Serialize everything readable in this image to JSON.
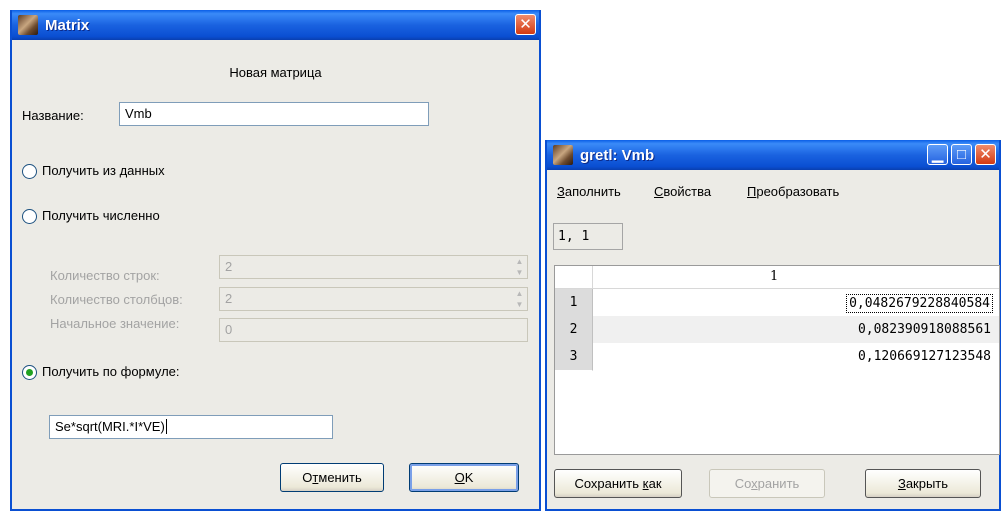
{
  "matrix_dialog": {
    "title": "Matrix",
    "subtitle": "Новая матрица",
    "name_label": "Название:",
    "name_value": "Vmb",
    "option_from_data": "Получить из данных",
    "option_numeric": "Получить численно",
    "rows_label": "Количество строк:",
    "rows_value": "2",
    "cols_label": "Количество столбцов:",
    "cols_value": "2",
    "init_label": "Начальное значение:",
    "init_value": "0",
    "option_formula": "Получить по формуле:",
    "formula_value": "Se*sqrt(MRI.*I*VE)",
    "selected_option": "formula",
    "cancel_prefix": "О",
    "cancel_mnemonic": "т",
    "cancel_suffix": "менить",
    "ok_mnemonic": "O",
    "ok_suffix": "K"
  },
  "gretl_window": {
    "title": "gretl: Vmb",
    "menu": {
      "fill_mnemonic": "З",
      "fill_rest": "аполнить",
      "props_mnemonic": "С",
      "props_rest": "войства",
      "transform_mnemonic": "П",
      "transform_rest": "реобразовать"
    },
    "cell_ref": "1, 1",
    "column_header": "1",
    "rows": [
      {
        "label": "1",
        "value": "0,0482679228840584"
      },
      {
        "label": "2",
        "value": "0,082390918088561"
      },
      {
        "label": "3",
        "value": "0,120669127123548"
      }
    ],
    "buttons": {
      "save_as_prefix": "Сохранить ",
      "save_as_mnemonic": "к",
      "save_as_suffix": "ак",
      "save_prefix": "Со",
      "save_mnemonic": "х",
      "save_suffix": "ранить",
      "close_mnemonic": "З",
      "close_rest": "акрыть"
    }
  },
  "colors": {
    "titlebar": "#0a5ee6",
    "dialog_bg": "#ecebe6",
    "radio_selected": "#21a121"
  }
}
